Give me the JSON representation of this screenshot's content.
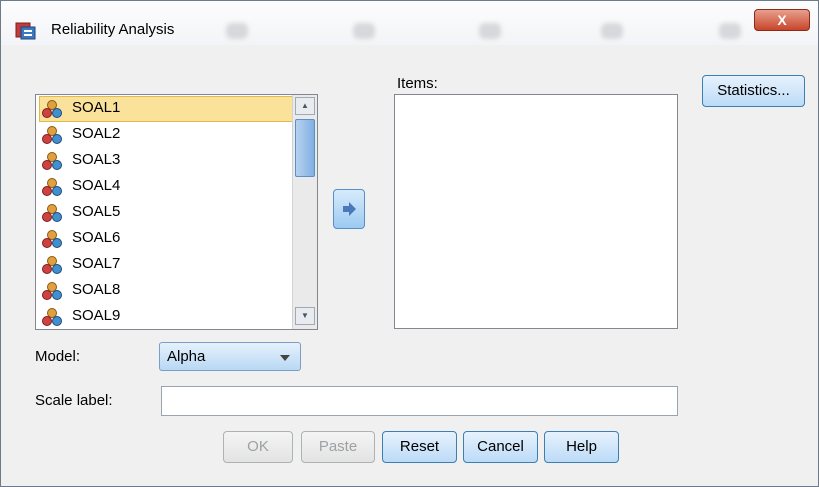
{
  "window": {
    "title": "Reliability Analysis",
    "close_label": "X"
  },
  "variables": {
    "label": "",
    "items": [
      "SOAL1",
      "SOAL2",
      "SOAL3",
      "SOAL4",
      "SOAL5",
      "SOAL6",
      "SOAL7",
      "SOAL8",
      "SOAL9"
    ],
    "selected": "SOAL1",
    "icon": "scale-variable-icon"
  },
  "items_panel": {
    "label": "Items:",
    "items": []
  },
  "move_button": {
    "icon": "arrow-right-icon"
  },
  "statistics_button": {
    "label": "Statistics..."
  },
  "model": {
    "label": "Model:",
    "value": "Alpha"
  },
  "scale_label": {
    "label": "Scale label:",
    "value": ""
  },
  "buttons": {
    "ok": "OK",
    "paste": "Paste",
    "reset": "Reset",
    "cancel": "Cancel",
    "help": "Help"
  },
  "colors": {
    "selection": "#fbe29a",
    "button_blue": "#bcdbf7",
    "close_red": "#c8452a"
  }
}
